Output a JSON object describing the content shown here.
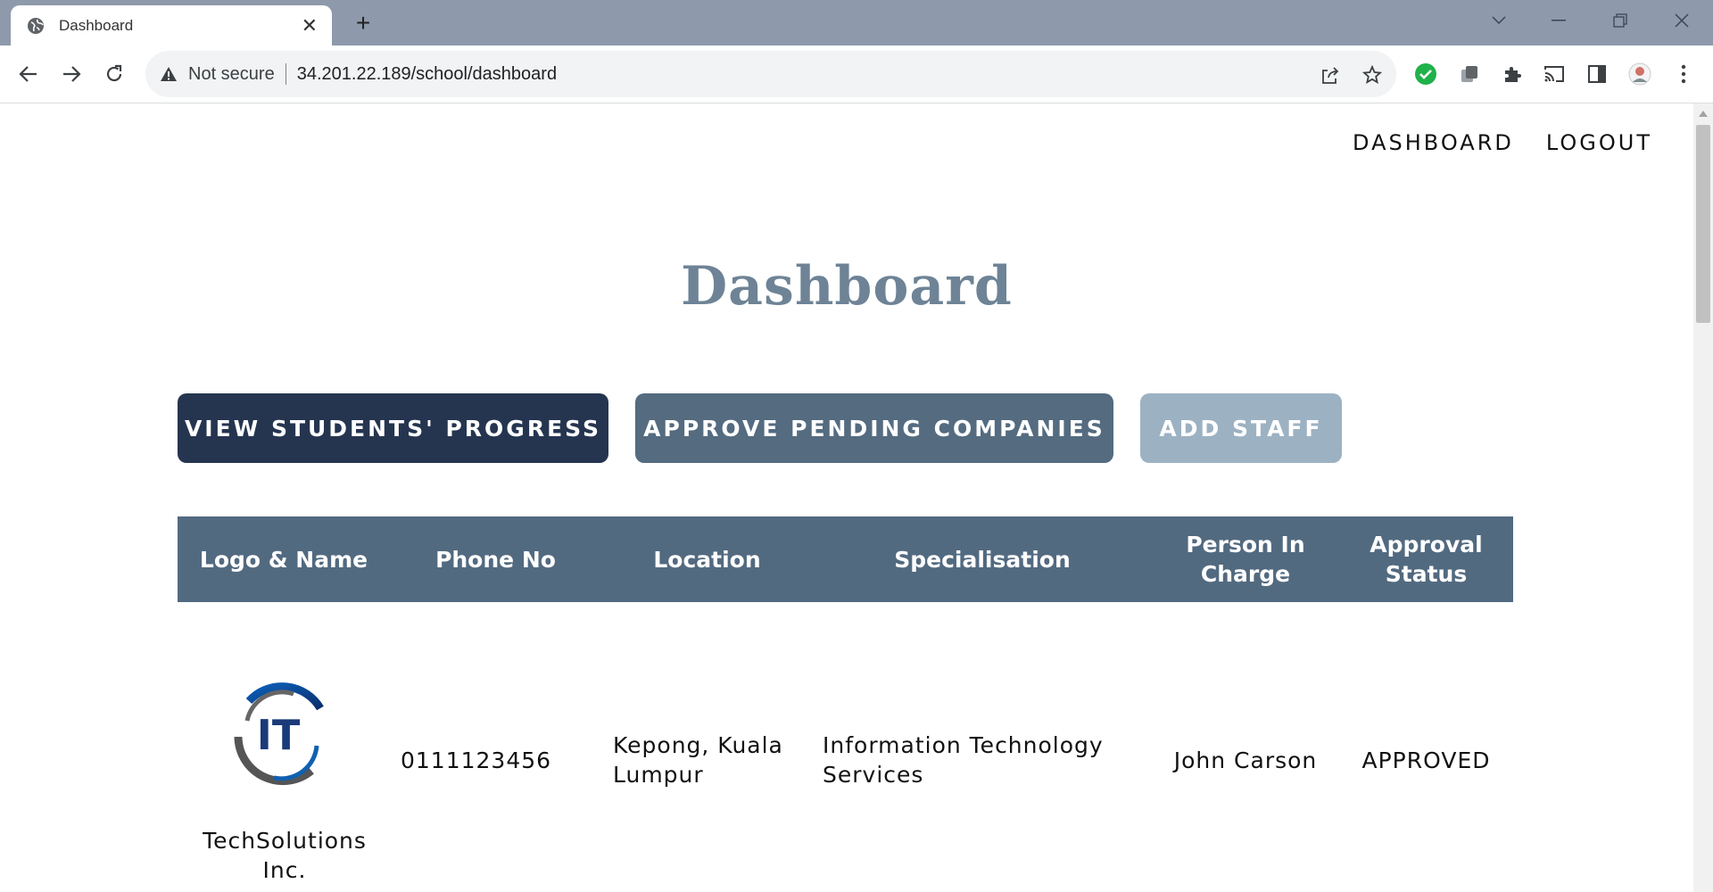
{
  "browser": {
    "tab_title": "Dashboard",
    "new_tab_symbol": "+",
    "close_symbol": "✕",
    "security_label": "Not secure",
    "url": "34.201.22.189/school/dashboard"
  },
  "nav": {
    "dashboard": "DASHBOARD",
    "logout": "LOGOUT"
  },
  "page": {
    "title": "Dashboard"
  },
  "actions": {
    "view_progress": "VIEW STUDENTS' PROGRESS",
    "approve_companies": "APPROVE PENDING COMPANIES",
    "add_staff": "ADD STAFF"
  },
  "table": {
    "headers": [
      "Logo & Name",
      "Phone No",
      "Location",
      "Specialisation",
      "Person In Charge",
      "Approval Status"
    ],
    "rows": [
      {
        "logo_text": "IT",
        "name": "TechSolutions Inc.",
        "phone": "0111123456",
        "location": "Kepong, Kuala Lumpur",
        "specialisation": "Information Technology Services",
        "person_in_charge": "John Carson",
        "status": "APPROVED"
      }
    ]
  },
  "colors": {
    "primary_dark": "#253550",
    "primary_mid": "#546b80",
    "primary_light": "#9cb2c3",
    "title": "#6e8396"
  }
}
